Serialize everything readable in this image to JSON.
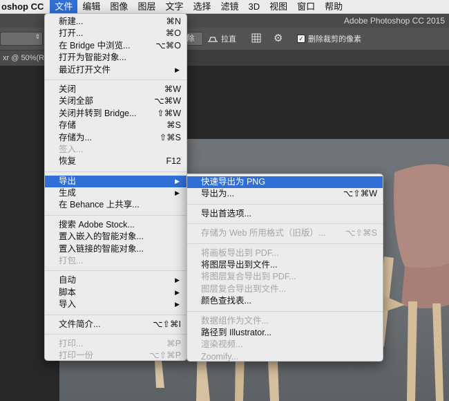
{
  "menubar": {
    "app_name": "oshop CC",
    "items": [
      "文件",
      "编辑",
      "图像",
      "图层",
      "文字",
      "选择",
      "滤镜",
      "3D",
      "视图",
      "窗口",
      "帮助"
    ]
  },
  "titlebar": {
    "app_title": "Adobe Photoshop CC 2015"
  },
  "optionsbar": {
    "clear_label": "除",
    "straighten_label": "拉直",
    "delete_cropped_label": "删除裁剪的像素",
    "delete_cropped_checked": true
  },
  "document": {
    "tab_title": "xr @ 50%(RG"
  },
  "file_menu": {
    "groups": [
      [
        {
          "label": "新建...",
          "shortcut": "⌘N"
        },
        {
          "label": "打开...",
          "shortcut": "⌘O"
        },
        {
          "label": "在 Bridge 中浏览...",
          "shortcut": "⌥⌘O"
        },
        {
          "label": "打开为智能对象..."
        },
        {
          "label": "最近打开文件",
          "submenu": true
        }
      ],
      [
        {
          "label": "关闭",
          "shortcut": "⌘W"
        },
        {
          "label": "关闭全部",
          "shortcut": "⌥⌘W"
        },
        {
          "label": "关闭并转到 Bridge...",
          "shortcut": "⇧⌘W"
        },
        {
          "label": "存储",
          "shortcut": "⌘S"
        },
        {
          "label": "存储为...",
          "shortcut": "⇧⌘S"
        },
        {
          "label": "签入...",
          "disabled": true
        },
        {
          "label": "恢复",
          "shortcut": "F12"
        }
      ],
      [
        {
          "label": "导出",
          "submenu": true,
          "highlighted": true
        },
        {
          "label": "生成",
          "submenu": true
        },
        {
          "label": "在 Behance 上共享..."
        }
      ],
      [
        {
          "label": "搜索 Adobe Stock..."
        },
        {
          "label": "置入嵌入的智能对象..."
        },
        {
          "label": "置入链接的智能对象..."
        },
        {
          "label": "打包...",
          "disabled": true
        }
      ],
      [
        {
          "label": "自动",
          "submenu": true
        },
        {
          "label": "脚本",
          "submenu": true
        },
        {
          "label": "导入",
          "submenu": true
        }
      ],
      [
        {
          "label": "文件简介...",
          "shortcut": "⌥⇧⌘I"
        }
      ],
      [
        {
          "label": "打印...",
          "shortcut": "⌘P",
          "disabled": true
        },
        {
          "label": "打印一份",
          "shortcut": "⌥⇧⌘P",
          "disabled": true
        }
      ]
    ]
  },
  "export_menu": {
    "groups": [
      [
        {
          "label": "快速导出为 PNG",
          "highlighted": true
        },
        {
          "label": "导出为...",
          "shortcut": "⌥⇧⌘W"
        }
      ],
      [
        {
          "label": "导出首选项..."
        }
      ],
      [
        {
          "label": "存储为 Web 所用格式（旧版）...",
          "shortcut": "⌥⇧⌘S",
          "disabled": true
        }
      ],
      [
        {
          "label": "将画板导出到 PDF...",
          "disabled": true
        },
        {
          "label": "将图层导出到文件..."
        },
        {
          "label": "将图层复合导出到 PDF...",
          "disabled": true
        },
        {
          "label": "图层复合导出到文件...",
          "disabled": true
        },
        {
          "label": "颜色查找表..."
        }
      ],
      [
        {
          "label": "数据组作为文件...",
          "disabled": true
        },
        {
          "label": "路径到 Illustrator..."
        },
        {
          "label": "渲染视频...",
          "disabled": true
        },
        {
          "label": "Zoomify...",
          "disabled": true
        }
      ]
    ]
  },
  "colors": {
    "menu_highlight": "#2f6fd6",
    "menu_bg": "#ececec",
    "disabled_text": "#a5a5a5"
  }
}
